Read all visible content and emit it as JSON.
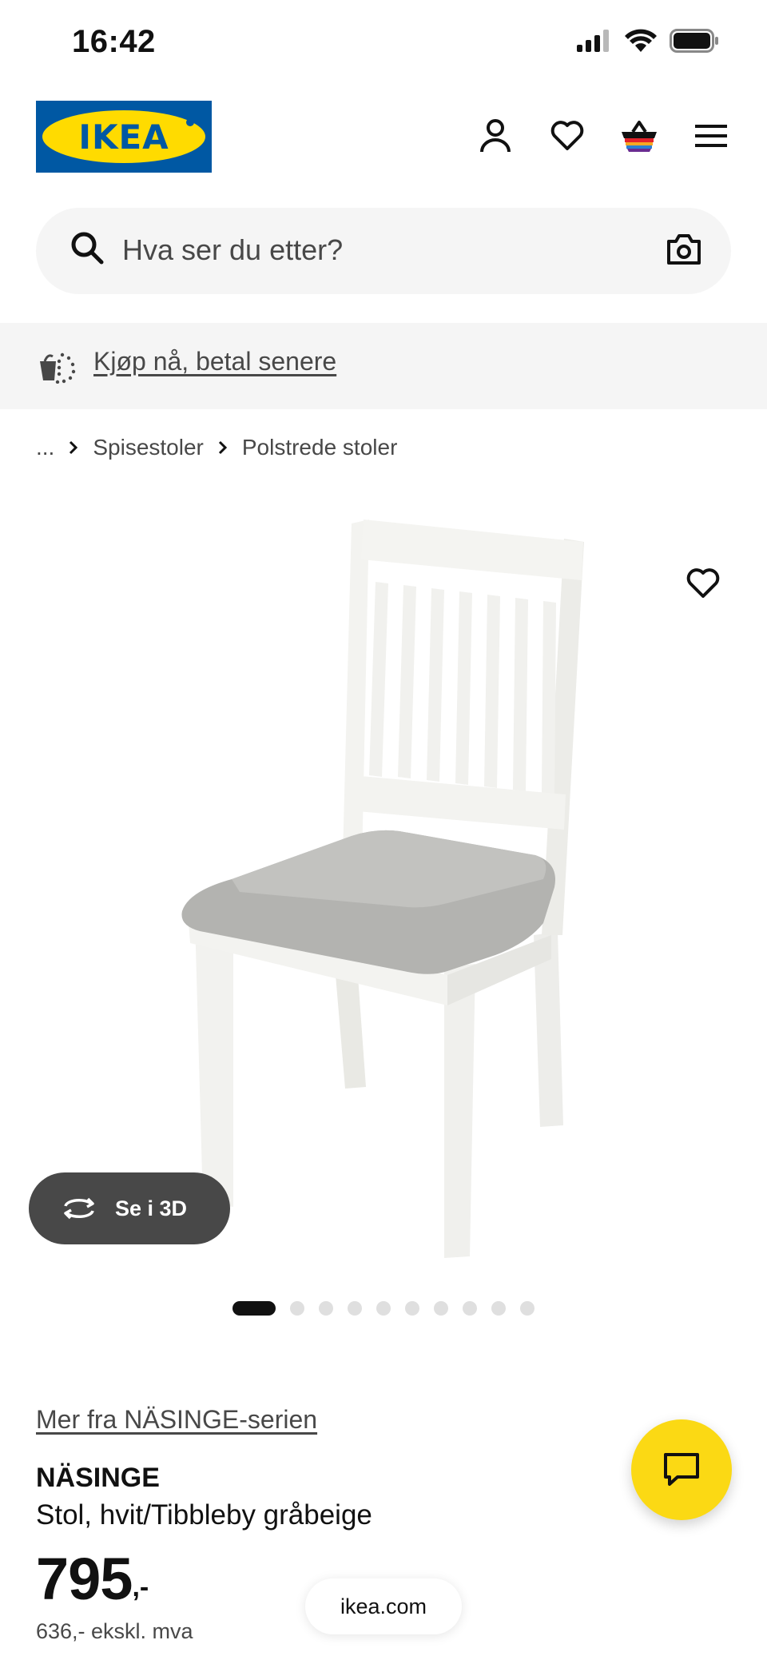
{
  "status_bar": {
    "time": "16:42",
    "icons": [
      "cellular-signal-icon",
      "wifi-icon",
      "battery-icon"
    ]
  },
  "header": {
    "logo_text": "IKEA",
    "icons": [
      "account-icon",
      "heart-icon",
      "basket-icon",
      "menu-icon"
    ]
  },
  "search": {
    "placeholder": "Hva ser du etter?",
    "icons": [
      "search-icon",
      "camera-icon"
    ]
  },
  "banner": {
    "link_text": "Kjøp nå, betal senere",
    "icon": "pay-later-icon"
  },
  "breadcrumb": {
    "items": [
      "...",
      "Spisestoler",
      "Polstrede stoler"
    ]
  },
  "gallery": {
    "image": "chair-image",
    "view_3d_label": "Se i 3D",
    "page_count": 10,
    "active_page": 1
  },
  "product": {
    "series_link": "Mer fra NÄSINGE-serien",
    "name": "NÄSINGE",
    "description": "Stol, hvit/Tibbleby gråbeige",
    "price_main": "795",
    "price_suffix": ",-",
    "price_ex_vat": "636,- ekskl. mva"
  },
  "browser": {
    "url": "ikea.com"
  },
  "colors": {
    "ikea_blue": "#0058a3",
    "ikea_yellow": "#ffdb00",
    "chat_yellow": "#fbd914",
    "text_dark": "#111111",
    "text_muted": "#484848",
    "surface_gray": "#f5f5f5"
  }
}
